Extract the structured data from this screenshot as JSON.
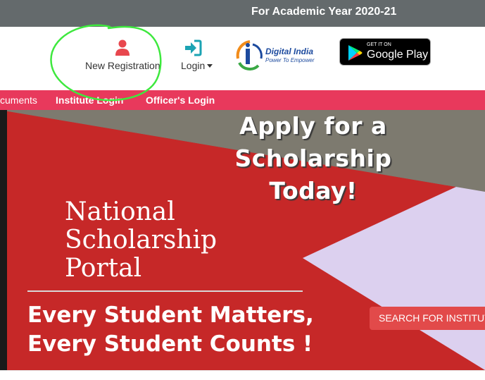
{
  "topbar": {
    "academic_year": "For Academic Year 2020-21"
  },
  "header": {
    "new_registration": {
      "label": "New Registration",
      "icon": "user-icon"
    },
    "login": {
      "label": "Login",
      "icon": "sign-in-icon"
    },
    "digital_india": {
      "title": "Digital India",
      "subtitle": "Power To Empower"
    },
    "google_play": {
      "get_it_on": "GET IT ON",
      "store": "Google Play"
    }
  },
  "nav": {
    "items": [
      {
        "label": "cuments"
      },
      {
        "label": "Institute Login"
      },
      {
        "label": "Officer's Login"
      }
    ]
  },
  "banner": {
    "apply_line1": "Apply for a",
    "apply_line2": "Scholarship",
    "apply_line3": "Today!",
    "nsp_line1": "National",
    "nsp_line2": "Scholarship",
    "nsp_line3": "Portal",
    "motto_line1": "Every Student Matters,",
    "motto_line2": "Every Student Counts !",
    "search_button": "SEARCH FOR INSTITUTE"
  },
  "colors": {
    "topbar": "#646a6c",
    "nav": "#e8395c",
    "banner_red": "#c62828",
    "banner_gray": "#7d7a6f",
    "banner_lavender": "#dcd0ef",
    "annotation_green": "#3ee83e"
  }
}
